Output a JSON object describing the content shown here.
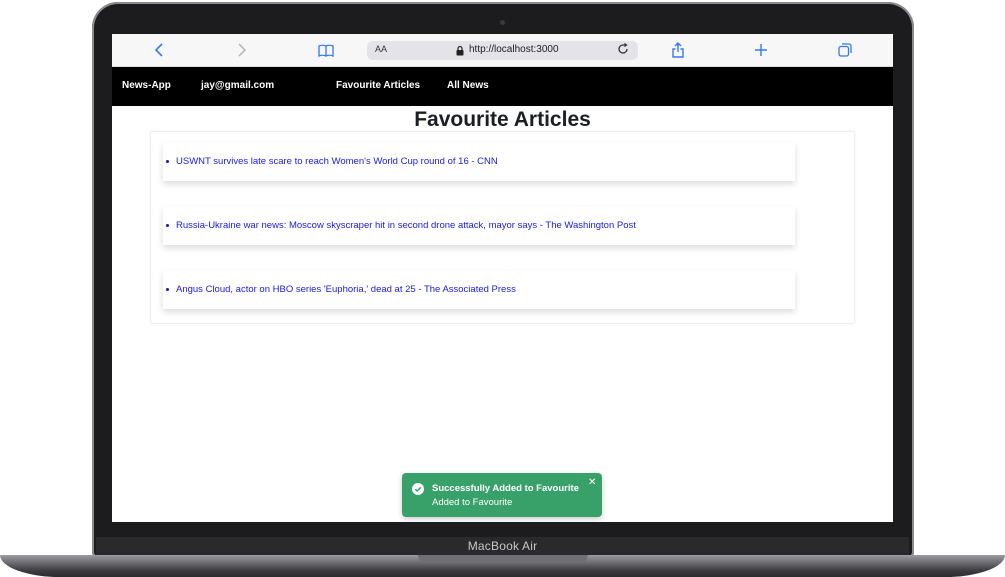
{
  "device": {
    "label": "MacBook Air"
  },
  "browser": {
    "text_size_label": "AA",
    "url": "http://localhost:3000"
  },
  "navbar": {
    "brand": "News-App",
    "user_email": "jay@gmail.com",
    "links": [
      {
        "label": "Favourite Articles"
      },
      {
        "label": "All News"
      }
    ]
  },
  "page": {
    "title": "Favourite Articles",
    "articles": [
      {
        "title": "USWNT survives late scare to reach Women's World Cup round of 16 - CNN"
      },
      {
        "title": "Russia-Ukraine war news: Moscow skyscraper hit in second drone attack, mayor says - The Washington Post"
      },
      {
        "title": "Angus Cloud, actor on HBO series 'Euphoria,' dead at 25 - The Associated Press"
      }
    ]
  },
  "toast": {
    "title": "Successfully Added to Favourite",
    "description": "Added to Favourite",
    "color": "#38a169"
  },
  "colors": {
    "link": "#1a1ae0",
    "navbar_bg": "#000000",
    "browser_accent": "#3478f6"
  },
  "icons": [
    "back-icon",
    "forward-icon",
    "book-icon",
    "lock-icon",
    "reload-icon",
    "share-icon",
    "plus-icon",
    "tabs-icon",
    "check-circle-icon",
    "close-icon"
  ]
}
